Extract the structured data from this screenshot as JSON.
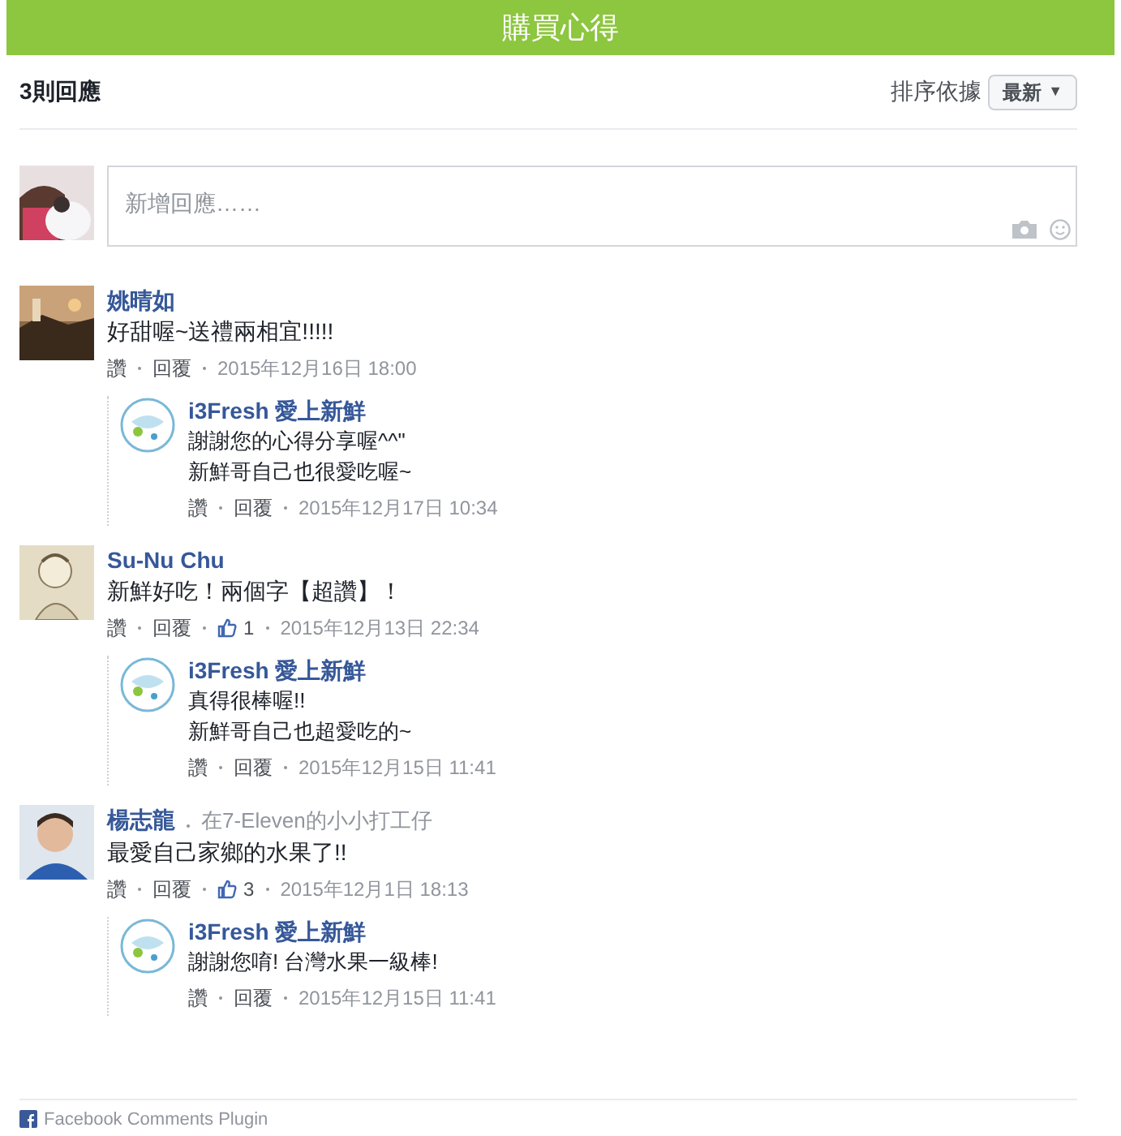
{
  "header": {
    "title": "購買心得"
  },
  "toolbar": {
    "count": "3則回應",
    "sort_label": "排序依據",
    "sort_value": "最新",
    "sort_caret": "▼"
  },
  "composer": {
    "placeholder": "新增回應……"
  },
  "comments": [
    {
      "author": "姚晴如",
      "lines": [
        "好甜喔~送禮兩相宜!!!!!"
      ],
      "like": "讚",
      "reply": "回覆",
      "time": "2015年12月16日 18:00",
      "replies": [
        {
          "author": "i3Fresh 愛上新鮮",
          "lines": [
            "謝謝您的心得分享喔^^\"",
            "新鮮哥自己也很愛吃喔~"
          ],
          "like": "讚",
          "reply": "回覆",
          "time": "2015年12月17日 10:34"
        }
      ]
    },
    {
      "author": "Su-Nu Chu",
      "lines": [
        "新鮮好吃！兩個字【超讚】！"
      ],
      "like": "讚",
      "reply": "回覆",
      "likes": "1",
      "time": "2015年12月13日 22:34",
      "replies": [
        {
          "author": "i3Fresh 愛上新鮮",
          "lines": [
            "真得很棒喔!!",
            "新鮮哥自己也超愛吃的~"
          ],
          "like": "讚",
          "reply": "回覆",
          "time": "2015年12月15日 11:41"
        }
      ]
    },
    {
      "author": "楊志龍",
      "subtitle": "在7-Eleven的小小打工仔",
      "lines": [
        "最愛自己家鄉的水果了!!"
      ],
      "like": "讚",
      "reply": "回覆",
      "likes": "3",
      "time": "2015年12月1日 18:13",
      "replies": [
        {
          "author": "i3Fresh 愛上新鮮",
          "lines": [
            "謝謝您唷! 台灣水果一級棒!"
          ],
          "like": "讚",
          "reply": "回覆",
          "time": "2015年12月15日 11:41"
        }
      ]
    }
  ],
  "footer": {
    "text": "Facebook Comments Plugin"
  }
}
